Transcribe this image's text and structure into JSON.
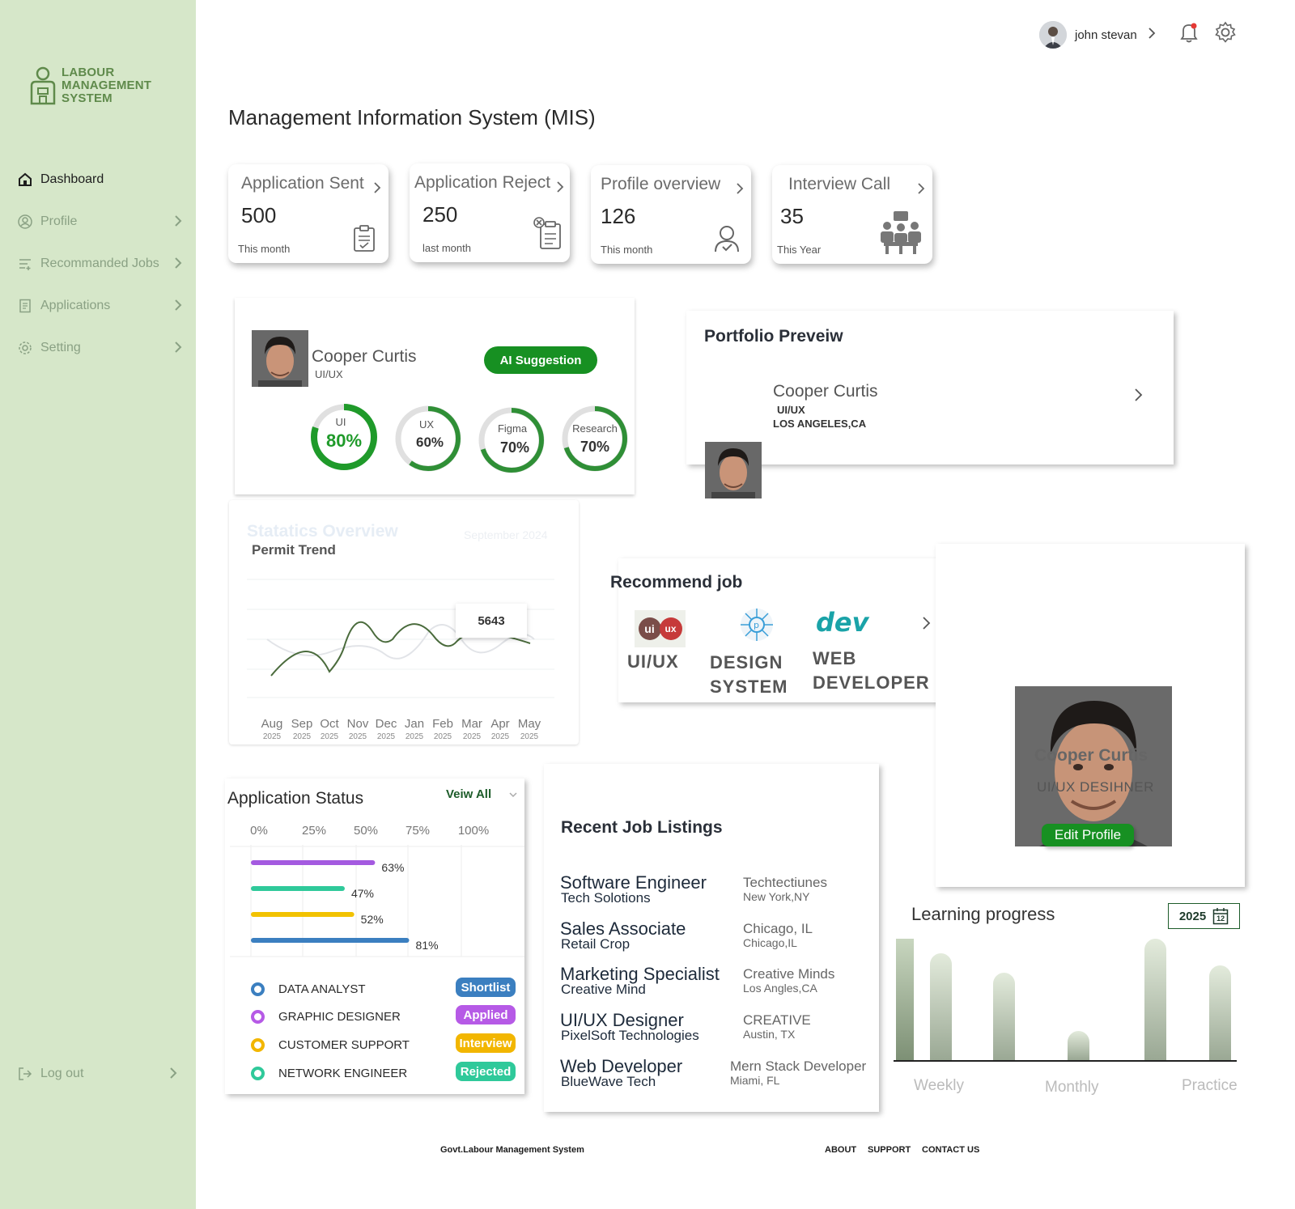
{
  "brand": {
    "line1": "LABOUR",
    "line2": "MANAGEMENT",
    "line3": "SYSTEM"
  },
  "nav": {
    "dashboard": "Dashboard",
    "profile": "Profile",
    "recommended": "Recommanded Jobs",
    "applications": "Applications",
    "setting": "Setting",
    "logout": "Log out"
  },
  "header": {
    "user_name": "john stevan"
  },
  "page_title": "Management Information System (MIS)",
  "stats": [
    {
      "title": "Application Sent",
      "value": "500",
      "sub": "This month"
    },
    {
      "title": "Application Reject",
      "value": "250",
      "sub": "last month"
    },
    {
      "title": "Profile overview",
      "value": "126",
      "sub": "This month"
    },
    {
      "title": "Interview Call",
      "value": "35",
      "sub": "This Year"
    }
  ],
  "ai_card": {
    "name": "Cooper Curtis",
    "role": "UI/UX",
    "button": "AI Suggestion",
    "skills": [
      {
        "label": "UI",
        "value": "80%",
        "fraction": 0.8
      },
      {
        "label": "UX",
        "value": "60%",
        "fraction": 0.6
      },
      {
        "label": "Figma",
        "value": "70%",
        "fraction": 0.7
      },
      {
        "label": "Research",
        "value": "70%",
        "fraction": 0.7
      }
    ]
  },
  "portfolio": {
    "title": "Portfolio Preveiw",
    "name": "Cooper Curtis",
    "role": "UI/UX",
    "location": "LOS ANGELES,CA"
  },
  "stats_overview": {
    "title": "Statatics Overview",
    "date": "September 2024",
    "subtitle": "Permit Trend",
    "tooltip": "5643",
    "months": [
      {
        "m": "Aug",
        "y": "2025"
      },
      {
        "m": "Sep",
        "y": "2025"
      },
      {
        "m": "Oct",
        "y": "2025"
      },
      {
        "m": "Nov",
        "y": "2025"
      },
      {
        "m": "Dec",
        "y": "2025"
      },
      {
        "m": "Jan",
        "y": "2025"
      },
      {
        "m": "Feb",
        "y": "2025"
      },
      {
        "m": "Mar",
        "y": "2025"
      },
      {
        "m": "Apr",
        "y": "2025"
      },
      {
        "m": "May",
        "y": "2025"
      }
    ]
  },
  "recommend": {
    "title": "Recommend job",
    "items": [
      {
        "label1": "UI/UX",
        "label2": ""
      },
      {
        "label1": "DESIGN",
        "label2": "SYSTEM"
      },
      {
        "label1": "WEB",
        "label2": "DEVELOPER"
      }
    ],
    "logo_ui": "ui",
    "logo_ux": "ux",
    "logo_dev": "dev"
  },
  "profile_card": {
    "name": "Cooper Curtis",
    "role": "UI/UX DESIHNER",
    "button": "Edit Profile"
  },
  "app_status": {
    "title": "Application Status",
    "view_all": "Veiw All",
    "axis": [
      "0%",
      "25%",
      "50%",
      "75%",
      "100%"
    ],
    "bars": [
      {
        "label": "63%",
        "value": 63,
        "color": "#a45ae0"
      },
      {
        "label": "47%",
        "value": 47,
        "color": "#2fc99a"
      },
      {
        "label": "52%",
        "value": 52,
        "color": "#f2c200"
      },
      {
        "label": "81%",
        "value": 81,
        "color": "#3b7fc0"
      }
    ],
    "rows": [
      {
        "name": "DATA ANALYST",
        "badge": "Shortlist",
        "color": "#3b7fc0"
      },
      {
        "name": "GRAPHIC DESIGNER",
        "badge": "Applied",
        "color": "#b65ae6"
      },
      {
        "name": "CUSTOMER SUPPORT",
        "badge": "Interview",
        "color": "#f2b600"
      },
      {
        "name": "NETWORK ENGINEER",
        "badge": "Rejected",
        "color": "#2fc99a"
      }
    ]
  },
  "recent_jobs": {
    "title": "Recent Job Listings",
    "items": [
      {
        "title": "Software Engineer",
        "company": "Tech Solotions",
        "loc1": "Techtectiunes",
        "loc2": "New York,NY"
      },
      {
        "title": "Sales Associate",
        "company": "Retail Crop",
        "loc1": "Chicago, IL",
        "loc2": "Chicago,IL"
      },
      {
        "title": "Marketing Specialist",
        "company": "Creative Mind",
        "loc1": "Creative Minds",
        "loc2": "Los Angles,CA"
      },
      {
        "title": "UI/UX Designer",
        "company": "PixelSoft Technologies",
        "loc1": "CREATIVE",
        "loc2": "Austin, TX"
      },
      {
        "title": "Web Developer",
        "company": "BlueWave Tech",
        "loc1": "Mern Stack Developer",
        "loc2": "Miami, FL"
      }
    ]
  },
  "learning": {
    "title": "Learning progress",
    "year": "2025",
    "cal_day": "12",
    "labels": [
      "Weekly",
      "Monthly",
      "Practice"
    ],
    "bars": [
      1.0,
      0.88,
      0.72,
      0.24,
      1.0,
      0.78
    ]
  },
  "footer": {
    "left": "Govt.Labour Management System",
    "about": "ABOUT",
    "support": "SUPPORT",
    "contact": "CONTACT US"
  },
  "colors": {
    "sidebar": "#d6e7c9",
    "brand": "#5f8a4b",
    "accent_green": "#179022",
    "ring_green": "#1f9a2a"
  }
}
